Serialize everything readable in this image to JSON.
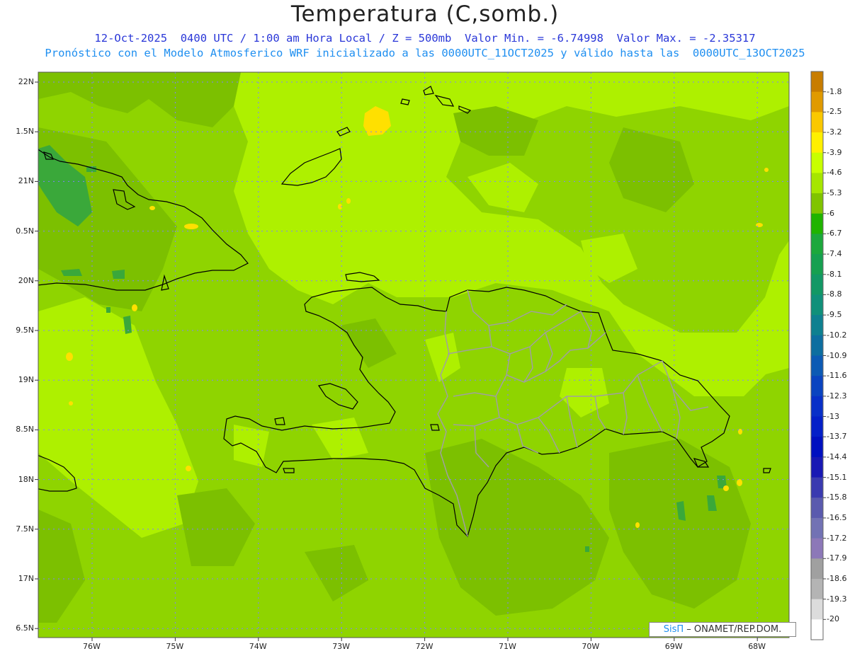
{
  "title": "Temperatura (C,somb.)",
  "subtitle_line1": "12-Oct-2025  0400 UTC / 1:00 am Hora Local / Z = 500mb  Valor Min. = -6.74998  Valor Max. = -2.35317",
  "subtitle_line2": "Pronóstico con el Modelo Atmosferico WRF inicializado a las 0000UTC_11OCT2025 y válido hasta las  0000UTC_13OCT2025",
  "credit": {
    "sis": "SisΠ",
    "rest": " – ONAMET/REP.DOM."
  },
  "lat_labels": [
    "22N",
    "1.5N",
    "21N",
    "0.5N",
    "20N",
    "9.5N",
    "19N",
    "8.5N",
    "18N",
    "7.5N",
    "17N",
    "6.5N"
  ],
  "lon_labels": [
    "76W",
    "75W",
    "74W",
    "73W",
    "72W",
    "71W",
    "70W",
    "69W",
    "68W"
  ],
  "colorbar": {
    "labels": [
      "-1.8",
      "-2.5",
      "-3.2",
      "-3.9",
      "-4.6",
      "-5.3",
      "-6",
      "-6.7",
      "-7.4",
      "-8.1",
      "-8.8",
      "-9.5",
      "-10.2",
      "-10.9",
      "-11.6",
      "-12.3",
      "-13",
      "-13.7",
      "-14.4",
      "-15.1",
      "-15.8",
      "-16.5",
      "-17.2",
      "-17.9",
      "-18.6",
      "-19.3",
      "-20"
    ],
    "colors": [
      "#c87d00",
      "#e09a00",
      "#fac800",
      "#fff000",
      "#c8ff00",
      "#a6e600",
      "#80c400",
      "#20b400",
      "#1ca83c",
      "#16a050",
      "#129865",
      "#10907a",
      "#0e8090",
      "#0d6ea0",
      "#0c5ab4",
      "#0a44c0",
      "#0830c8",
      "#0420c8",
      "#0010c0",
      "#1818b4",
      "#3a3ab0",
      "#5a5aae",
      "#7272b4",
      "#8c78b8",
      "#a0a0a0",
      "#b4b4b4",
      "#dcdcdc",
      "#ffffff"
    ]
  },
  "field_colors": {
    "base": "#8fd400",
    "light": "#aef000",
    "dark": "#7cc000",
    "green": "#3aa83a",
    "yellow": "#ffe000"
  },
  "line_colors": {
    "coast": "#000000",
    "provinces": "#a0a0a0",
    "grid": "#8080ff"
  }
}
